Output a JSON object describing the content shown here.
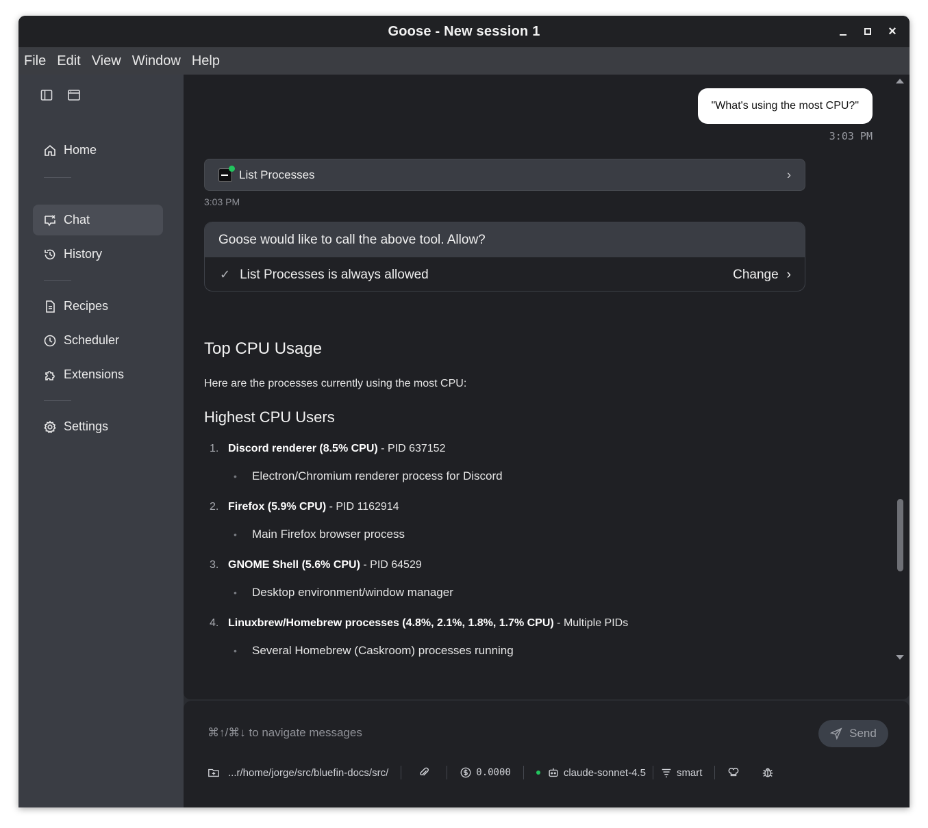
{
  "window": {
    "title": "Goose - New session 1"
  },
  "menu": [
    "File",
    "Edit",
    "View",
    "Window",
    "Help"
  ],
  "sidebar": {
    "items": [
      {
        "label": "Home",
        "icon": "home-icon"
      },
      {
        "label": "Chat",
        "icon": "chat-icon",
        "active": true
      },
      {
        "label": "History",
        "icon": "history-icon"
      },
      {
        "label": "Recipes",
        "icon": "recipe-icon"
      },
      {
        "label": "Scheduler",
        "icon": "clock-icon"
      },
      {
        "label": "Extensions",
        "icon": "puzzle-icon"
      },
      {
        "label": "Settings",
        "icon": "gear-icon"
      }
    ]
  },
  "chat": {
    "user_message": "\"What's using the most CPU?\"",
    "user_time": "3:03 PM",
    "tool": {
      "label": "List Processes",
      "time": "3:03 PM"
    },
    "permission": {
      "question": "Goose would like to call the above tool. Allow?",
      "status": "List Processes is always allowed",
      "change_label": "Change"
    },
    "response": {
      "heading": "Top CPU Usage",
      "intro": "Here are the processes currently using the most CPU:",
      "subheading": "Highest CPU Users",
      "items": [
        {
          "num": "1.",
          "bold": "Discord renderer (8.5% CPU)",
          "rest": " - PID 637152",
          "sub": "Electron/Chromium renderer process for Discord"
        },
        {
          "num": "2.",
          "bold": "Firefox (5.9% CPU)",
          "rest": " - PID 1162914",
          "sub": "Main Firefox browser process"
        },
        {
          "num": "3.",
          "bold": "GNOME Shell (5.6% CPU)",
          "rest": " - PID 64529",
          "sub": "Desktop environment/window manager"
        },
        {
          "num": "4.",
          "bold": "Linuxbrew/Homebrew processes (4.8%, 2.1%, 1.8%, 1.7% CPU)",
          "rest": " - Multiple PIDs",
          "sub": "Several Homebrew (Caskroom) processes running"
        }
      ]
    }
  },
  "composer": {
    "placeholder": "⌘↑/⌘↓ to navigate messages",
    "send_label": "Send",
    "directory": "...r/home/jorge/src/bluefin-docs/src/",
    "cost": "0.0000",
    "model": "claude-sonnet-4.5",
    "mode": "smart"
  }
}
